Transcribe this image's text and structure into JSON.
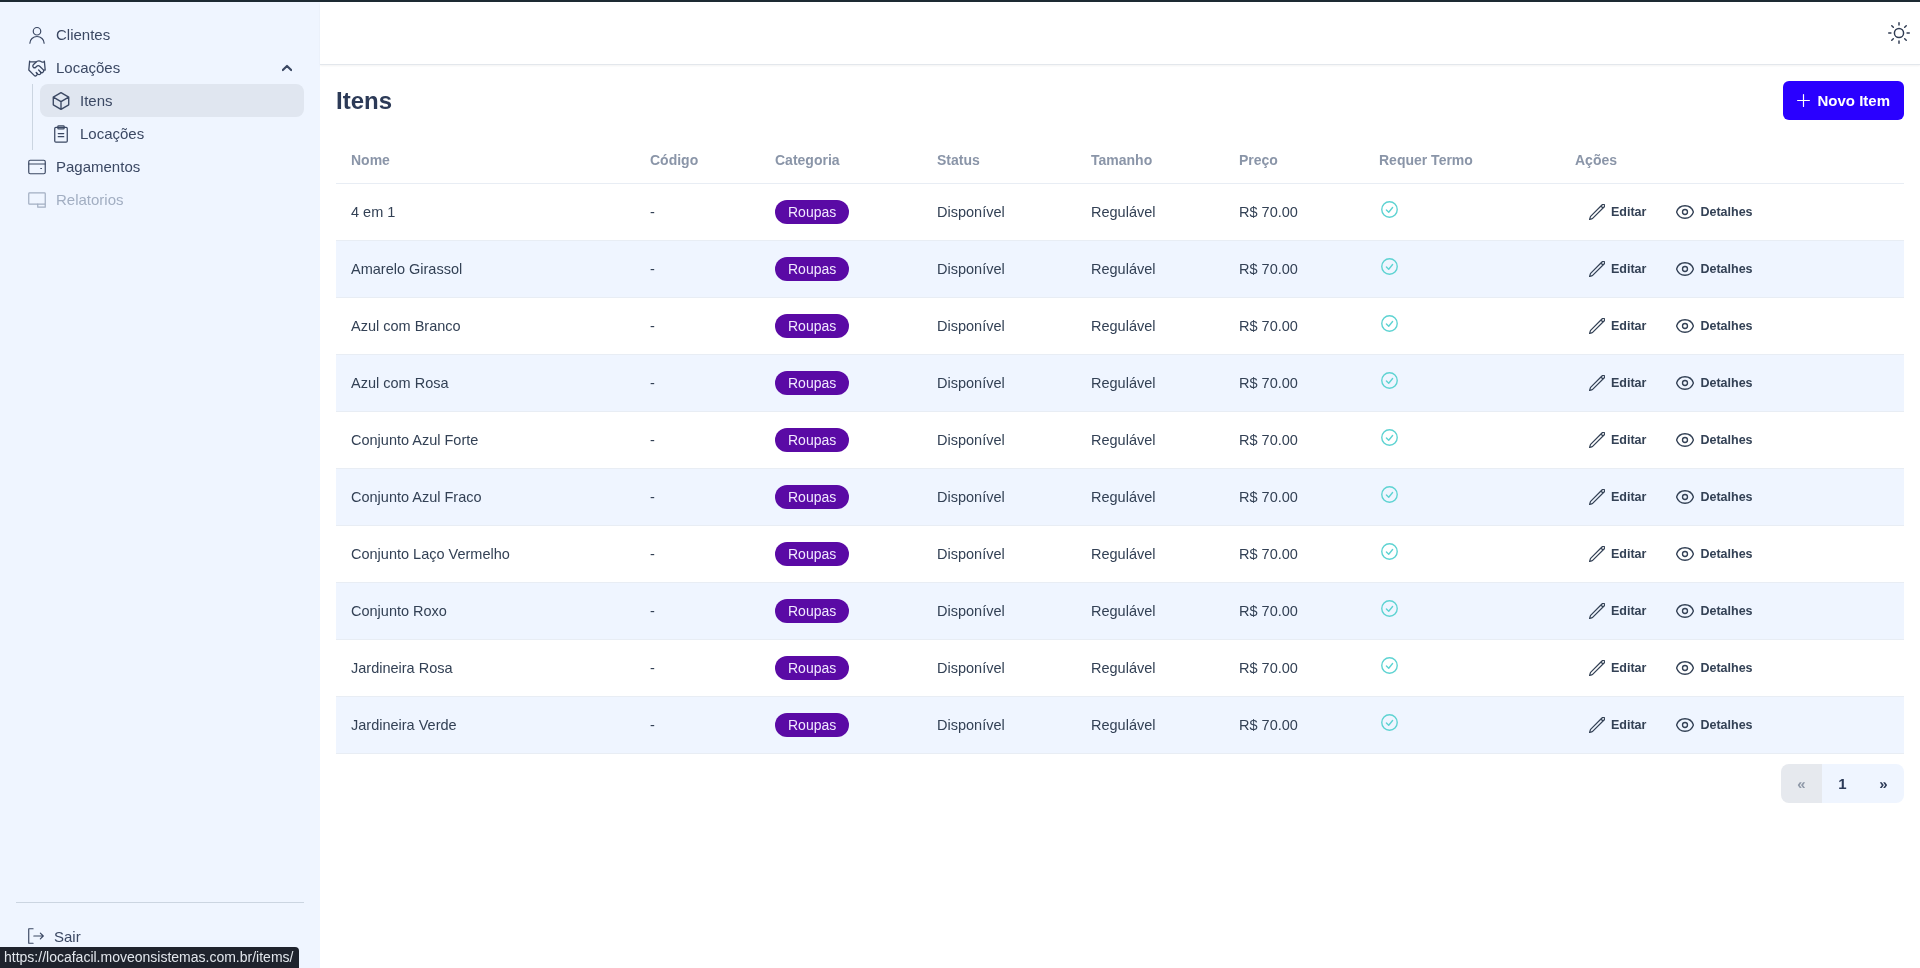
{
  "sidebar": {
    "items": [
      {
        "label": "Clientes",
        "selected": false,
        "disabled": false
      },
      {
        "label": "Locações",
        "selected": false,
        "disabled": false,
        "expanded": true,
        "children": [
          {
            "label": "Itens",
            "selected": true
          },
          {
            "label": "Locações",
            "selected": false
          }
        ]
      },
      {
        "label": "Pagamentos",
        "selected": false,
        "disabled": false
      },
      {
        "label": "Relatorios",
        "selected": false,
        "disabled": true
      }
    ],
    "logout": "Sair"
  },
  "page": {
    "title": "Itens",
    "new_button": "Novo Item"
  },
  "table": {
    "columns": [
      "Nome",
      "Código",
      "Categoria",
      "Status",
      "Tamanho",
      "Preço",
      "Requer Termo",
      "Ações"
    ],
    "rows": [
      {
        "name": "4 em 1",
        "code": "-",
        "category": "Roupas",
        "status": "Disponível",
        "size": "Regulável",
        "price": "R$ 70.00",
        "requires_term": true,
        "actions": [
          {
            "kind": "edit",
            "label": "Editar"
          },
          {
            "kind": "details",
            "label": "Detalhes"
          }
        ]
      },
      {
        "name": "Amarelo Girassol",
        "code": "-",
        "category": "Roupas",
        "status": "Disponível",
        "size": "Regulável",
        "price": "R$ 70.00",
        "requires_term": true,
        "actions": [
          {
            "kind": "edit",
            "label": "Editar"
          },
          {
            "kind": "details",
            "label": "Detalhes"
          }
        ]
      },
      {
        "name": "Azul com Branco",
        "code": "-",
        "category": "Roupas",
        "status": "Disponível",
        "size": "Regulável",
        "price": "R$ 70.00",
        "requires_term": true,
        "actions": [
          {
            "kind": "edit",
            "label": "Editar"
          },
          {
            "kind": "details",
            "label": "Detalhes"
          }
        ]
      },
      {
        "name": "Azul com Rosa",
        "code": "-",
        "category": "Roupas",
        "status": "Disponível",
        "size": "Regulável",
        "price": "R$ 70.00",
        "requires_term": true,
        "actions": [
          {
            "kind": "edit",
            "label": "Editar"
          },
          {
            "kind": "details",
            "label": "Detalhes"
          }
        ]
      },
      {
        "name": "Conjunto Azul Forte",
        "code": "-",
        "category": "Roupas",
        "status": "Disponível",
        "size": "Regulável",
        "price": "R$ 70.00",
        "requires_term": true,
        "actions": [
          {
            "kind": "edit",
            "label": "Editar"
          },
          {
            "kind": "details",
            "label": "Detalhes"
          }
        ]
      },
      {
        "name": "Conjunto Azul Fraco",
        "code": "-",
        "category": "Roupas",
        "status": "Disponível",
        "size": "Regulável",
        "price": "R$ 70.00",
        "requires_term": true,
        "actions": [
          {
            "kind": "edit",
            "label": "Editar"
          },
          {
            "kind": "details",
            "label": "Detalhes"
          }
        ]
      },
      {
        "name": "Conjunto Laço Vermelho",
        "code": "-",
        "category": "Roupas",
        "status": "Disponível",
        "size": "Regulável",
        "price": "R$ 70.00",
        "requires_term": true,
        "actions": [
          {
            "kind": "edit",
            "label": "Editar"
          },
          {
            "kind": "details",
            "label": "Detalhes"
          }
        ]
      },
      {
        "name": "Conjunto Roxo",
        "code": "-",
        "category": "Roupas",
        "status": "Disponível",
        "size": "Regulável",
        "price": "R$ 70.00",
        "requires_term": true,
        "actions": [
          {
            "kind": "edit",
            "label": "Editar"
          },
          {
            "kind": "details",
            "label": "Detalhes"
          }
        ]
      },
      {
        "name": "Jardineira Rosa",
        "code": "-",
        "category": "Roupas",
        "status": "Disponível",
        "size": "Regulável",
        "price": "R$ 70.00",
        "requires_term": true,
        "actions": [
          {
            "kind": "edit",
            "label": "Editar"
          },
          {
            "kind": "details",
            "label": "Detalhes"
          }
        ]
      },
      {
        "name": "Jardineira Verde",
        "code": "-",
        "category": "Roupas",
        "status": "Disponível",
        "size": "Regulável",
        "price": "R$ 70.00",
        "requires_term": true,
        "actions": [
          {
            "kind": "edit",
            "label": "Editar"
          },
          {
            "kind": "details",
            "label": "Detalhes"
          }
        ]
      }
    ]
  },
  "pagination": [
    {
      "label": "«",
      "disabled": true
    },
    {
      "label": "1",
      "disabled": false
    },
    {
      "label": "»",
      "disabled": false
    }
  ],
  "status_bar": {
    "url": "https://locafacil.moveonsistemas.com.br/items/"
  }
}
